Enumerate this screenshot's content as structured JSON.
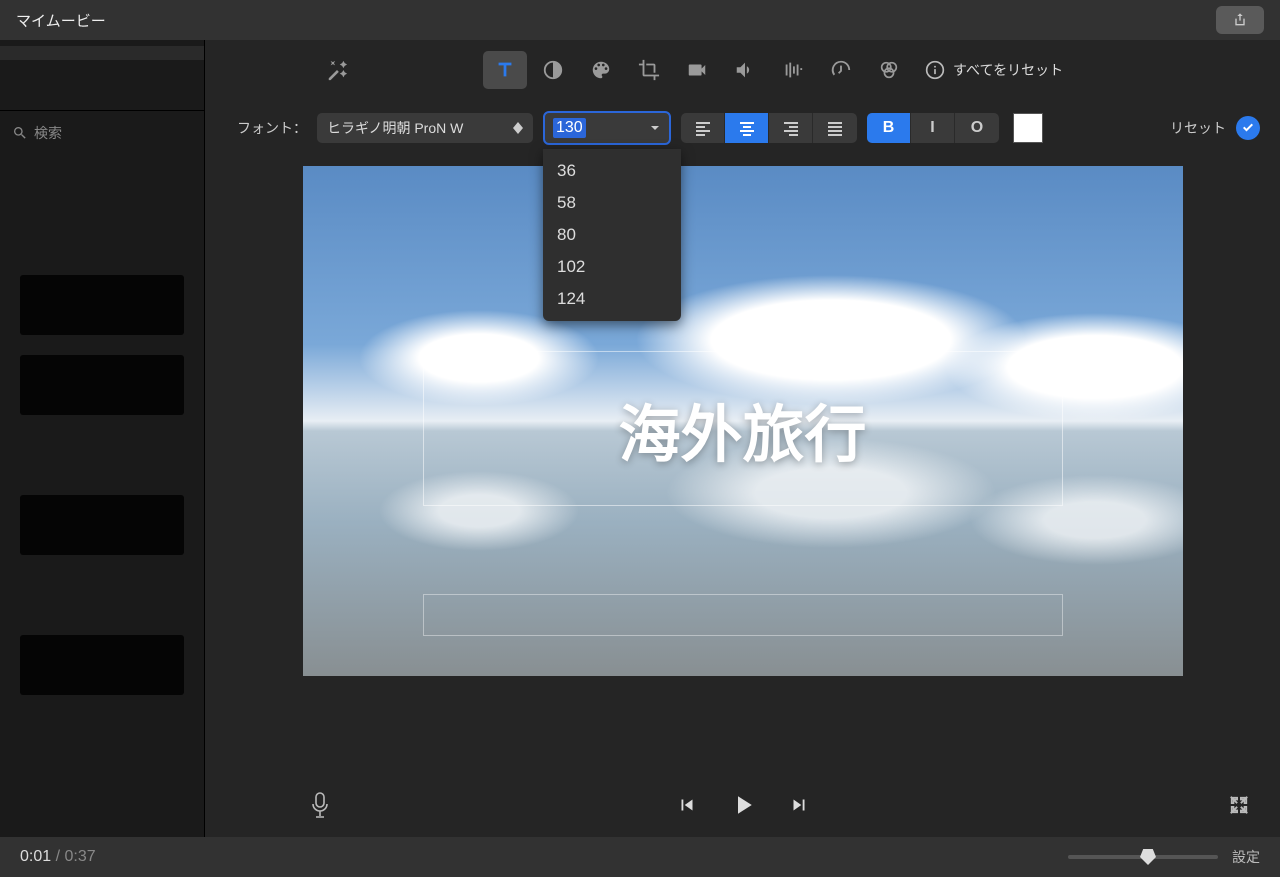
{
  "titlebar": {
    "title": "マイムービー"
  },
  "sidebar": {
    "search_placeholder": "検索"
  },
  "font_toolbar": {
    "label": "フォント：",
    "font_name": "ヒラギノ明朝 ProN W",
    "size_value": "130",
    "size_options": [
      "36",
      "58",
      "80",
      "102",
      "124"
    ],
    "bold": "B",
    "italic": "I",
    "outline": "O",
    "reset_label": "リセット"
  },
  "adjustments": {
    "reset_all": "すべてをリセット"
  },
  "preview": {
    "title_text": "海外旅行"
  },
  "footer": {
    "current_time": "0:01",
    "separator": " / ",
    "total_time": "0:37",
    "settings_label": "設定"
  }
}
